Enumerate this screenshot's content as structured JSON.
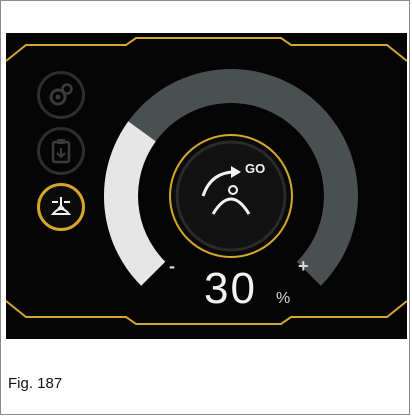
{
  "display": {
    "level_percent": 30,
    "value_text": "30",
    "unit": "%",
    "decrease_label": "-",
    "increase_label": "+",
    "center_button": {
      "label": "GO"
    }
  },
  "sidebar": {
    "items": [
      {
        "icon": "gears-icon",
        "active": false
      },
      {
        "icon": "clipboard-icon",
        "active": false
      },
      {
        "icon": "pressure-foot-icon",
        "active": true
      }
    ]
  },
  "colors": {
    "accent": "#d4a62a",
    "fill": "#e6e6e6",
    "track": "#4a4f50",
    "background": "#050505"
  },
  "caption": "Fig. 187"
}
